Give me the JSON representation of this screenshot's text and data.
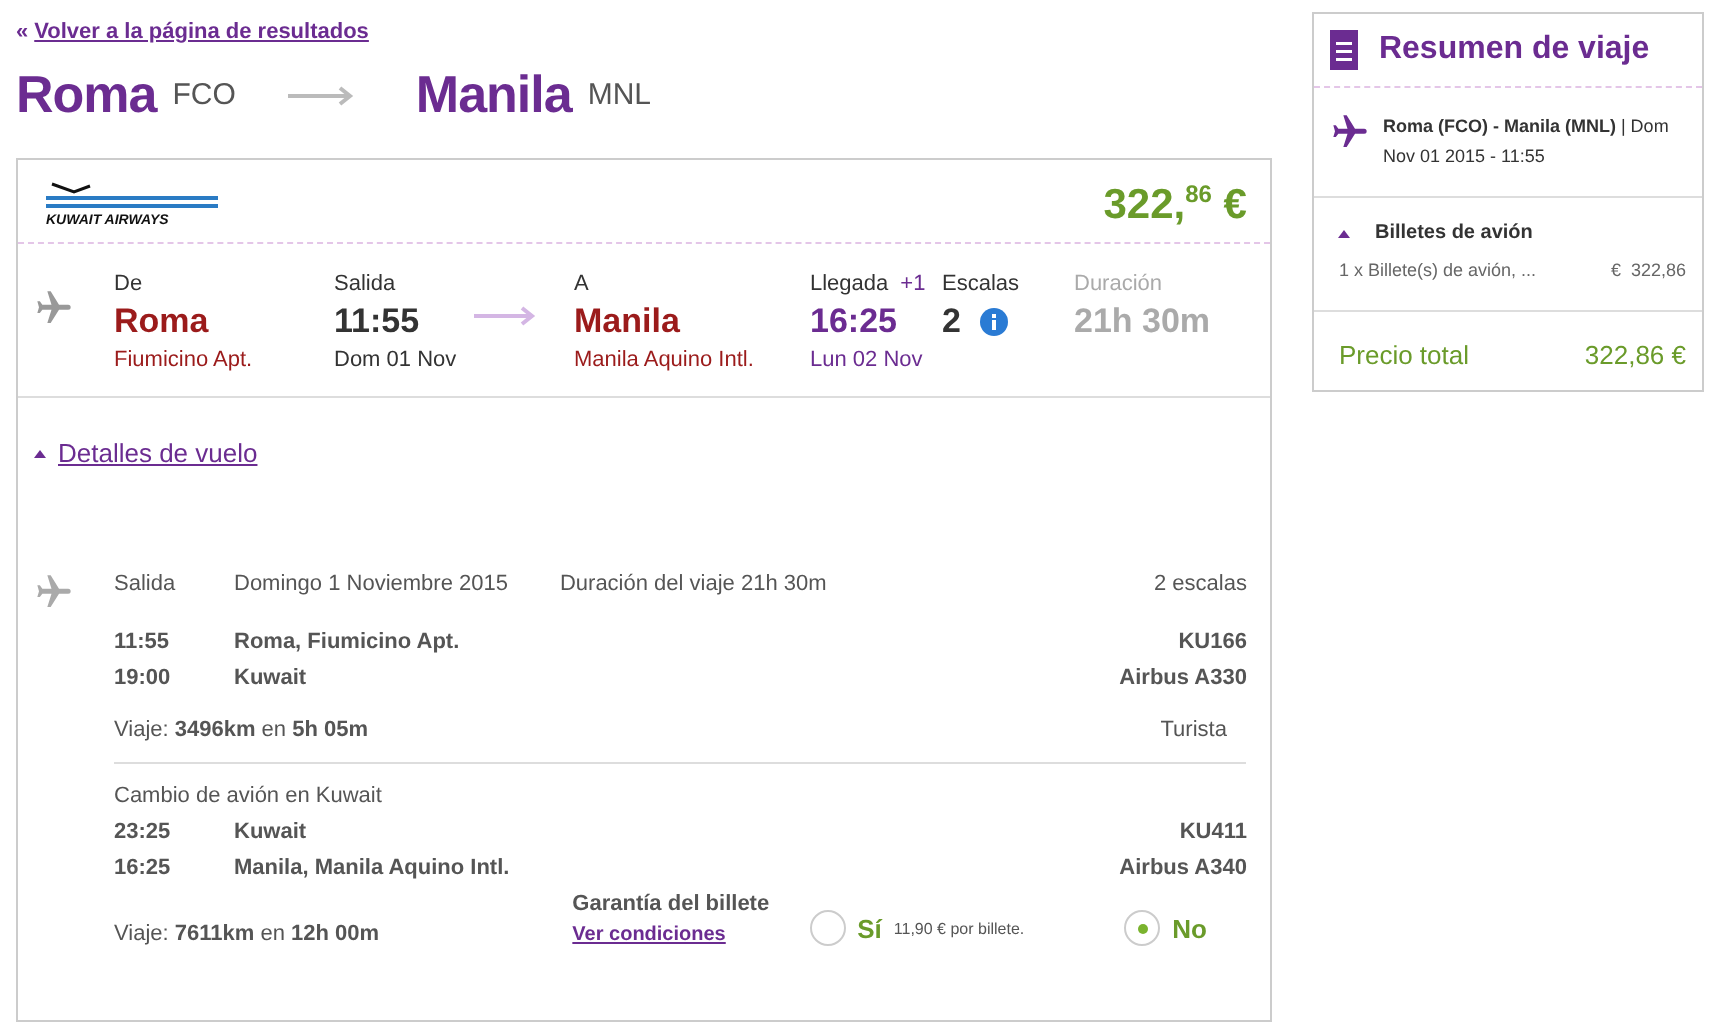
{
  "back_link": {
    "arrow": "«",
    "label": "Volver a la página de resultados"
  },
  "route": {
    "from_city": "Roma",
    "from_code": "FCO",
    "to_city": "Manila",
    "to_code": "MNL"
  },
  "flight_card": {
    "airline": "KUWAIT AIRWAYS",
    "price": "322,$^{86}$ €",
    "summary": {
      "from_label": "De",
      "from_city": "Roma",
      "from_airport": "Fiumicino Apt.",
      "dep_label": "Salida",
      "dep_time": "11:55",
      "dep_date": "Dom 01 Nov",
      "to_label": "A",
      "to_city": "Manila",
      "to_airport": "Manila Aquino Intl.",
      "arr_label": "Llegada",
      "arr_offset": "+1",
      "arr_time": "16:25",
      "arr_date": "Lun 02 Nov",
      "stops_label": "Escalas",
      "stops": "2",
      "duration_label": "Duración",
      "duration": "21h 30m"
    },
    "details": {
      "label": "Detalles de vuelo",
      "expanded": true
    },
    "itinerary": {
      "dep_label": "Salida",
      "date": "Domingo 1 Noviembre 2015",
      "trip_duration": "Duración del viaje 21h 30m",
      "stops": "2 escalas",
      "segments": [
        {
          "times": [
            {
              "time": "11:55",
              "place": "Roma, Fiumicino Apt.",
              "info": "KU166"
            },
            {
              "time": "19:00",
              "place": "Kuwait",
              "info": "Airbus A330"
            }
          ],
          "travel": "Viaje: **3496km** en **5h 05m**",
          "cabin": "Turista"
        },
        {
          "header": "Cambio de avión en Kuwait",
          "times": [
            {
              "time": "23:25",
              "place": "Kuwait",
              "info": "KU411"
            },
            {
              "time": "16:25",
              "place": "Manila, Manila Aquino Intl.",
              "info": "Airbus A340"
            }
          ],
          "travel": "Viaje: **7611km** en **12h 00m**"
        }
      ]
    },
    "guarantee": {
      "title": "Garantía del billete",
      "link": "Ver condiciones",
      "options": [
        {
          "label": "Sí",
          "note": "11,90 € por billete.",
          "selected": false
        },
        {
          "label": "No",
          "selected": true
        }
      ]
    }
  },
  "trip_summary": {
    "title": "Resumen de viaje",
    "flight": "**Roma (FCO) - Manila (MNL)** | Dom Nov 01 2015 - 11:55",
    "tickets": {
      "label": "Billetes de avión",
      "expanded": true,
      "item": "1 x Billete(s) de avión, ...",
      "amount": "€  322,86"
    },
    "total_label": "Precio total",
    "total": "322,86 €"
  }
}
